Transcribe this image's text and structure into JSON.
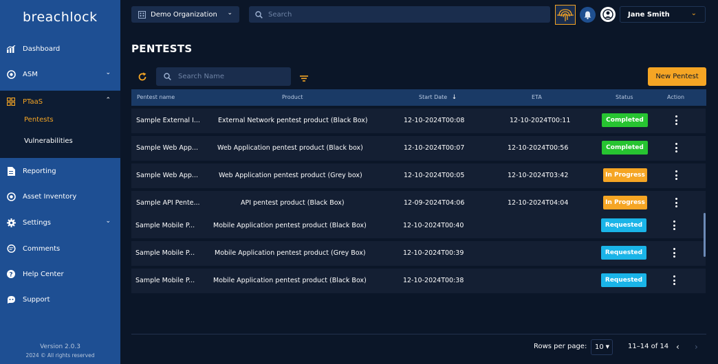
{
  "sidebar": {
    "logo_text": "breachlock",
    "items": [
      {
        "label": "Dashboard",
        "icon": "chart-icon"
      },
      {
        "label": "ASM",
        "icon": "target-icon"
      },
      {
        "label": "PTaaS",
        "icon": "grid-icon"
      },
      {
        "label": "Reporting",
        "icon": "report-icon"
      },
      {
        "label": "Asset Inventory",
        "icon": "asset-icon"
      },
      {
        "label": "Settings",
        "icon": "gear-icon"
      },
      {
        "label": "Comments",
        "icon": "comment-icon"
      },
      {
        "label": "Help Center",
        "icon": "help-icon"
      },
      {
        "label": "Support",
        "icon": "support-icon"
      }
    ],
    "ptaas_sub": [
      {
        "label": "Pentests"
      },
      {
        "label": "Vulnerabilities"
      }
    ],
    "version": "Version 2.0.3",
    "copyright": "2024 © All rights reserved"
  },
  "topbar": {
    "org": "Demo Organization",
    "search_placeholder": "Search",
    "user_name": "Jane Smith"
  },
  "main": {
    "title": "PENTESTS",
    "search_placeholder": "Search Name",
    "new_button": "New Pentest"
  },
  "table": {
    "headers": {
      "name": "Pentest name",
      "product": "Product",
      "start": "Start Date",
      "eta": "ETA",
      "status": "Status",
      "action": "Action"
    },
    "rows": [
      {
        "name": "Sample External I...",
        "product": "External Network pentest product (Black Box)",
        "start": "12-10-2024T00:08",
        "eta": "12-10-2024T00:11",
        "status": "Completed"
      },
      {
        "name": "Sample Web App...",
        "product": "Web Application pentest product (Black box)",
        "start": "12-10-2024T00:07",
        "eta": "12-10-2024T00:56",
        "status": "Completed"
      },
      {
        "name": "Sample Web App...",
        "product": "Web Application pentest product (Grey box)",
        "start": "12-10-2024T00:05",
        "eta": "12-10-2024T03:42",
        "status": "In Progress"
      },
      {
        "name": "Sample API Pente...",
        "product": "API pentest product (Black Box)",
        "start": "12-09-2024T04:06",
        "eta": "12-10-2024T04:04",
        "status": "In Progress"
      },
      {
        "name": "Sample Mobile P...",
        "product": "Mobile Application pentest product (Black Box)",
        "start": "12-10-2024T00:40",
        "eta": "",
        "status": "Requested"
      },
      {
        "name": "Sample Mobile P...",
        "product": "Mobile Application pentest product (Grey Box)",
        "start": "12-10-2024T00:39",
        "eta": "",
        "status": "Requested"
      },
      {
        "name": "Sample Mobile P...",
        "product": "Mobile Application pentest product (Black Box)",
        "start": "12-10-2024T00:38",
        "eta": "",
        "status": "Requested"
      }
    ]
  },
  "pagination": {
    "rows_per_page_label": "Rows per page:",
    "rows_per_page": "10",
    "range": "11–14 of 14"
  },
  "colors": {
    "accent": "#f5a524",
    "sidebar": "#1e4f93",
    "completed": "#27c431",
    "requested": "#1ab4e8"
  }
}
